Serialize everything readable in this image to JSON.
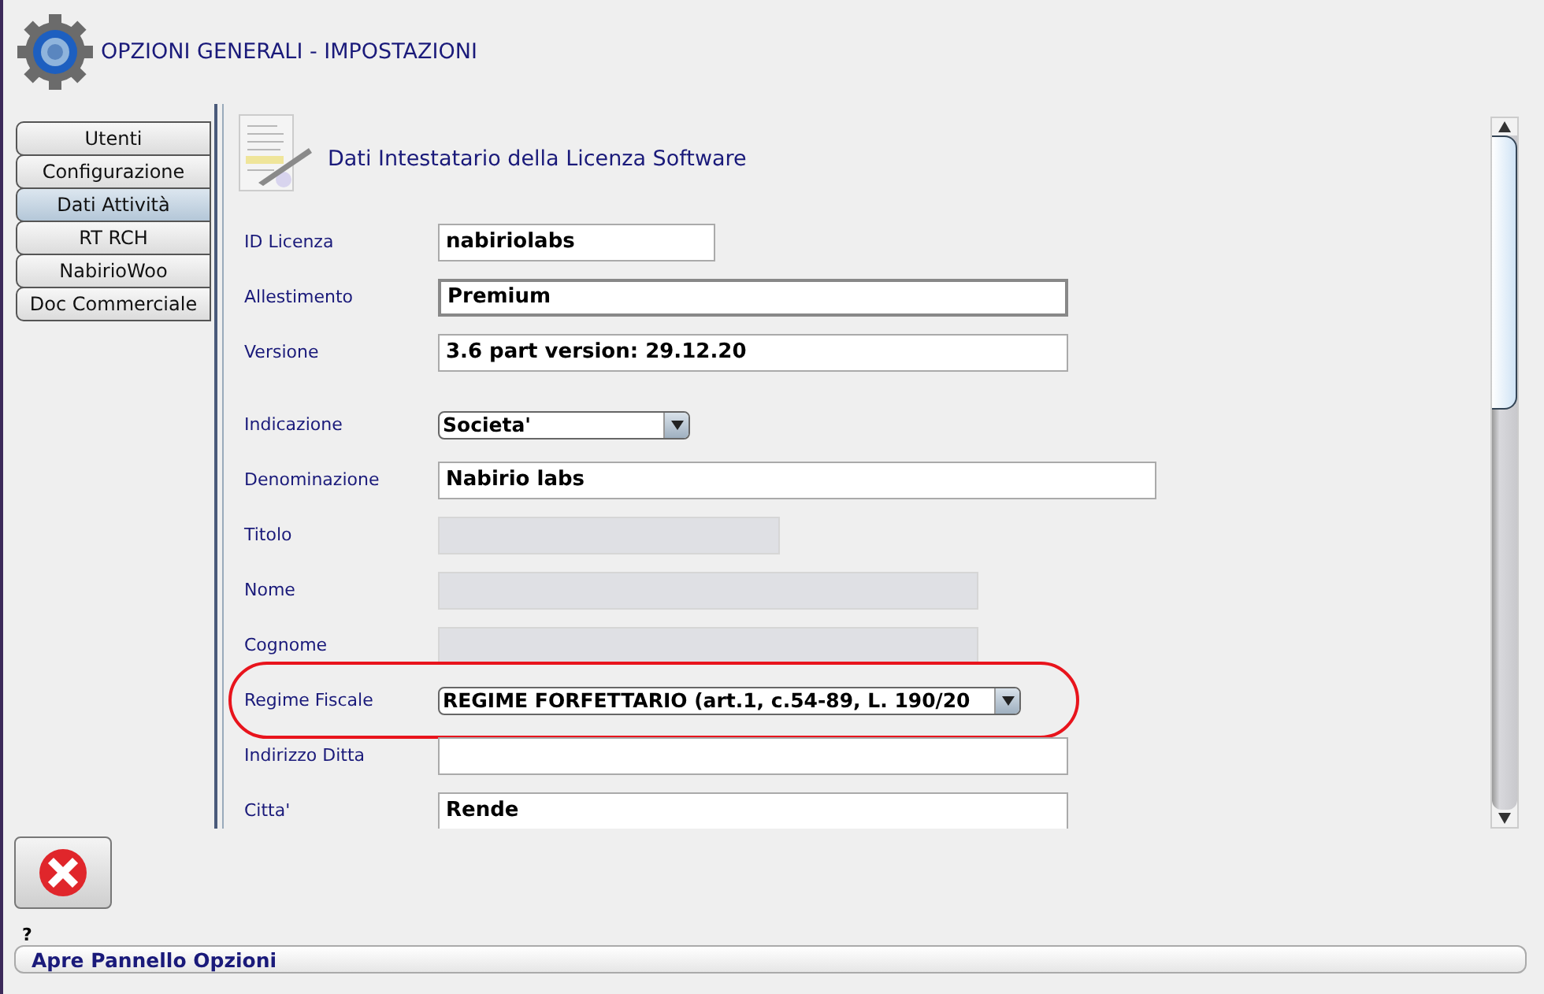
{
  "window": {
    "title": "OPZIONI GENERALI - IMPOSTAZIONI"
  },
  "tabs": [
    {
      "label": "Utenti",
      "selected": false
    },
    {
      "label": "Configurazione",
      "selected": false
    },
    {
      "label": "Dati Attività",
      "selected": true
    },
    {
      "label": "RT RCH",
      "selected": false
    },
    {
      "label": "NabirioWoo",
      "selected": false
    },
    {
      "label": "Doc Commerciale",
      "selected": false
    }
  ],
  "section": {
    "title": "Dati Intestatario della Licenza Software"
  },
  "fields": [
    {
      "label": "ID Licenza",
      "kind": "text",
      "value": "nabiriolabs",
      "focused": false,
      "highlighted": false
    },
    {
      "label": "Allestimento",
      "kind": "text",
      "value": "Premium",
      "focused": true,
      "highlighted": false
    },
    {
      "label": "Versione",
      "kind": "text",
      "value": "3.6 part version: 29.12.20",
      "focused": false,
      "highlighted": false
    },
    {
      "label": "Indicazione",
      "kind": "combo",
      "value": "Societa'",
      "focused": false,
      "highlighted": false
    },
    {
      "label": "Denominazione",
      "kind": "text",
      "value": "Nabirio labs",
      "focused": false,
      "highlighted": false
    },
    {
      "label": "Titolo",
      "kind": "disabled",
      "focused": false,
      "highlighted": false
    },
    {
      "label": "Nome",
      "kind": "disabled",
      "focused": false,
      "highlighted": false
    },
    {
      "label": "Cognome",
      "kind": "disabled",
      "focused": false,
      "highlighted": false
    },
    {
      "label": "Regime Fiscale",
      "kind": "combo",
      "value": "REGIME FORFETTARIO (art.1, c.54-89, L. 190/20",
      "focused": false,
      "highlighted": true
    },
    {
      "label": "Indirizzo Ditta",
      "kind": "text",
      "focused": false,
      "highlighted": false
    },
    {
      "label": "Citta'",
      "kind": "text",
      "value": "Rende",
      "focused": false,
      "highlighted": false
    }
  ],
  "help": {
    "mark": "?"
  },
  "status_bar": {
    "text": "Apre Pannello Opzioni"
  }
}
